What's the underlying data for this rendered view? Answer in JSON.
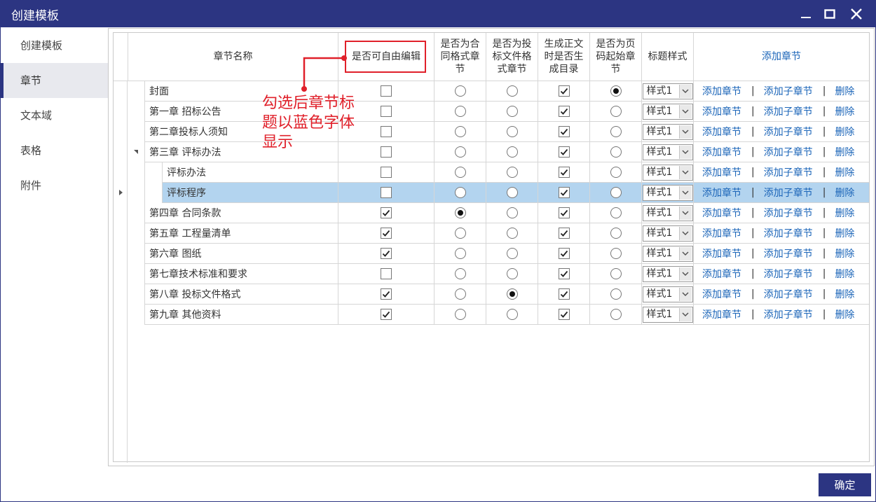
{
  "window": {
    "title": "创建模板"
  },
  "sidebar": {
    "items": [
      {
        "label": "创建模板",
        "active": false
      },
      {
        "label": "章节",
        "active": true
      },
      {
        "label": "文本域",
        "active": false
      },
      {
        "label": "表格",
        "active": false
      },
      {
        "label": "附件",
        "active": false
      }
    ]
  },
  "table": {
    "headers": {
      "name": "章节名称",
      "free_edit": "是否可自由编辑",
      "contract_format": "是否为合同格式章节",
      "bid_format": "是否为投标文件格式章节",
      "gen_toc": "生成正文时是否生成目录",
      "page_start": "是否为页码起始章节",
      "title_style": "标题样式",
      "add_chapter": "添加章节"
    },
    "ops": {
      "add": "添加章节",
      "add_sub": "添加子章节",
      "sep": "|",
      "delete": "删除"
    },
    "rows": [
      {
        "name": "封面",
        "level": 0,
        "free_edit": false,
        "contract": false,
        "bid": false,
        "toc": true,
        "page_start": true,
        "style": "样式1",
        "selected": false
      },
      {
        "name": "第一章 招标公告",
        "level": 0,
        "free_edit": false,
        "contract": false,
        "bid": false,
        "toc": true,
        "page_start": false,
        "style": "样式1",
        "selected": false
      },
      {
        "name": "第二章投标人须知",
        "level": 0,
        "free_edit": false,
        "contract": false,
        "bid": false,
        "toc": true,
        "page_start": false,
        "style": "样式1",
        "selected": false
      },
      {
        "name": "第三章 评标办法",
        "level": 0,
        "expanded": true,
        "free_edit": false,
        "contract": false,
        "bid": false,
        "toc": true,
        "page_start": false,
        "style": "样式1",
        "selected": false
      },
      {
        "name": "评标办法",
        "level": 1,
        "free_edit": false,
        "contract": false,
        "bid": false,
        "toc": true,
        "page_start": false,
        "style": "样式1",
        "selected": false
      },
      {
        "name": "评标程序",
        "level": 1,
        "free_edit": false,
        "contract": false,
        "bid": false,
        "toc": true,
        "page_start": false,
        "style": "样式1",
        "selected": true
      },
      {
        "name": "第四章 合同条款",
        "level": 0,
        "free_edit": true,
        "contract": true,
        "bid": false,
        "toc": true,
        "page_start": false,
        "style": "样式1",
        "selected": false
      },
      {
        "name": "第五章 工程量清单",
        "level": 0,
        "free_edit": true,
        "contract": false,
        "bid": false,
        "toc": true,
        "page_start": false,
        "style": "样式1",
        "selected": false
      },
      {
        "name": "第六章 图纸",
        "level": 0,
        "free_edit": true,
        "contract": false,
        "bid": false,
        "toc": true,
        "page_start": false,
        "style": "样式1",
        "selected": false
      },
      {
        "name": "第七章技术标准和要求",
        "level": 0,
        "free_edit": false,
        "contract": false,
        "bid": false,
        "toc": true,
        "page_start": false,
        "style": "样式1",
        "selected": false
      },
      {
        "name": "第八章 投标文件格式",
        "level": 0,
        "free_edit": true,
        "contract": false,
        "bid": true,
        "toc": true,
        "page_start": false,
        "style": "样式1",
        "selected": false
      },
      {
        "name": "第九章 其他资料",
        "level": 0,
        "free_edit": true,
        "contract": false,
        "bid": false,
        "toc": true,
        "page_start": false,
        "style": "样式1",
        "selected": false
      }
    ]
  },
  "annotation": {
    "text": "勾选后章节标题以蓝色字体显示",
    "color": "#e0202a"
  },
  "footer": {
    "ok_label": "确定"
  },
  "colors": {
    "titlebar": "#2c3582",
    "link": "#1a64b8",
    "selected_row": "#b3d4ef"
  }
}
